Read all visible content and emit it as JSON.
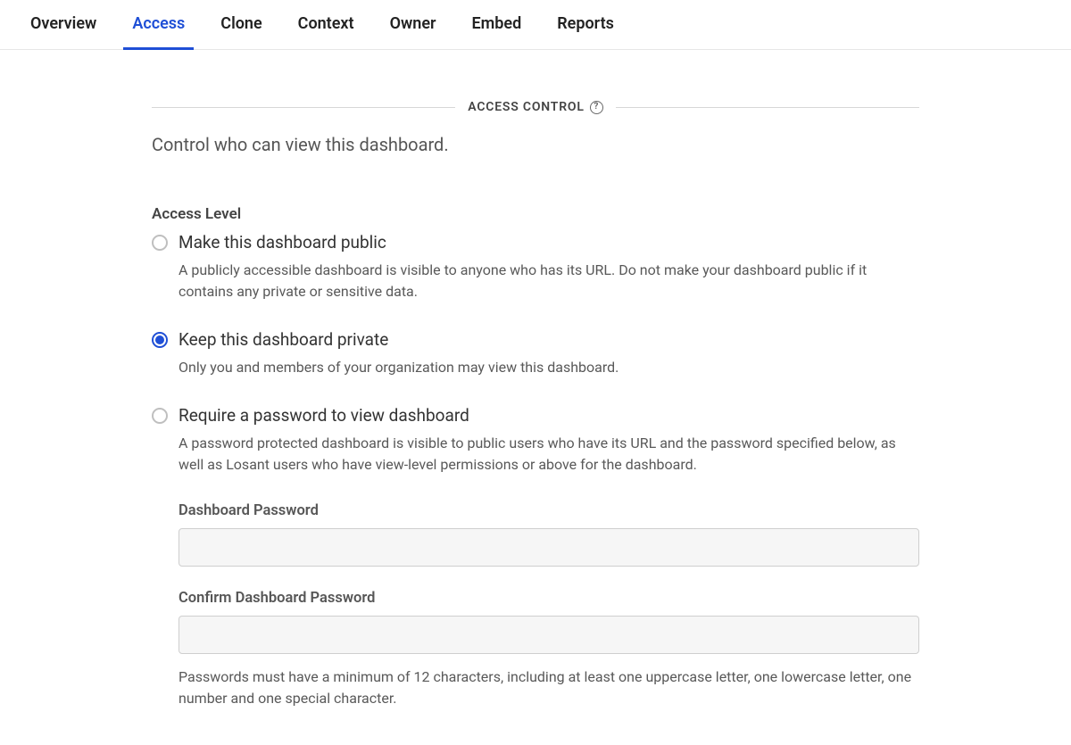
{
  "tabs": [
    {
      "label": "Overview",
      "active": false
    },
    {
      "label": "Access",
      "active": true
    },
    {
      "label": "Clone",
      "active": false
    },
    {
      "label": "Context",
      "active": false
    },
    {
      "label": "Owner",
      "active": false
    },
    {
      "label": "Embed",
      "active": false
    },
    {
      "label": "Reports",
      "active": false
    }
  ],
  "section": {
    "title": "ACCESS CONTROL",
    "subtitle": "Control who can view this dashboard."
  },
  "access_level": {
    "label": "Access Level",
    "options": [
      {
        "title": "Make this dashboard public",
        "desc": "A publicly accessible dashboard is visible to anyone who has its URL. Do not make your dashboard public if it contains any private or sensitive data.",
        "selected": false
      },
      {
        "title": "Keep this dashboard private",
        "desc": "Only you and members of your organization may view this dashboard.",
        "selected": true
      },
      {
        "title": "Require a password to view dashboard",
        "desc": "A password protected dashboard is visible to public users who have its URL and the password specified below, as well as Losant users who have view-level permissions or above for the dashboard.",
        "selected": false
      }
    ]
  },
  "password": {
    "label": "Dashboard Password",
    "value": "",
    "confirm_label": "Confirm Dashboard Password",
    "confirm_value": "",
    "hint": "Passwords must have a minimum of 12 characters, including at least one uppercase letter, one lowercase letter, one number and one special character."
  }
}
